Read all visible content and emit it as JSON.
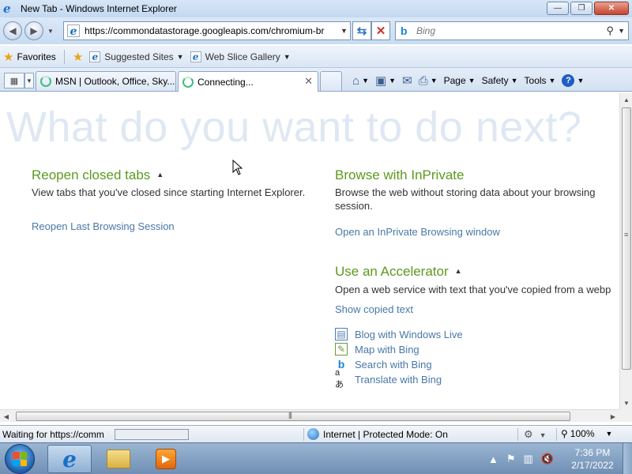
{
  "window": {
    "title": "New Tab - Windows Internet Explorer",
    "minimize": "—",
    "maximize": "❐",
    "close": "✕"
  },
  "address_bar": {
    "url": "https://commondatastorage.googleapis.com/chromium-br",
    "search_placeholder": "Bing"
  },
  "favorites_bar": {
    "favorites_label": "Favorites",
    "suggested_sites": "Suggested Sites",
    "web_slice_gallery": "Web Slice Gallery"
  },
  "tabs": [
    {
      "label": "MSN | Outlook, Office, Sky...",
      "active": false
    },
    {
      "label": "Connecting...",
      "active": true
    }
  ],
  "command_bar": {
    "page": "Page",
    "safety": "Safety",
    "tools": "Tools"
  },
  "content": {
    "heading": "What do you want to do next?",
    "reopen": {
      "title": "Reopen closed tabs",
      "description": "View tabs that you've closed since starting Internet Explorer.",
      "link": "Reopen Last Browsing Session"
    },
    "inprivate": {
      "title": "Browse with InPrivate",
      "description_line1": "Browse the web without storing data about your browsing",
      "description_line2": "session.",
      "link": "Open an InPrivate Browsing window"
    },
    "accelerator": {
      "title": "Use an Accelerator",
      "description": "Open a web service with text that you've copied from a webp",
      "show_copied": "Show copied text",
      "items": [
        {
          "label": "Blog with Windows Live",
          "icon": "blog-icon"
        },
        {
          "label": "Map with Bing",
          "icon": "map-icon"
        },
        {
          "label": "Search with Bing",
          "icon": "bing-icon"
        },
        {
          "label": "Translate with Bing",
          "icon": "translate-icon"
        }
      ]
    }
  },
  "status_bar": {
    "status": "Waiting for https://comm",
    "progress": 0.0,
    "zone": "Internet | Protected Mode: On",
    "zoom": "100%"
  },
  "taskbar": {
    "time": "7:36 PM",
    "date": "2/17/2022"
  },
  "colors": {
    "section_title": "#5a9a1f",
    "link": "#4978a8",
    "watermark": "#dfe8f2"
  }
}
